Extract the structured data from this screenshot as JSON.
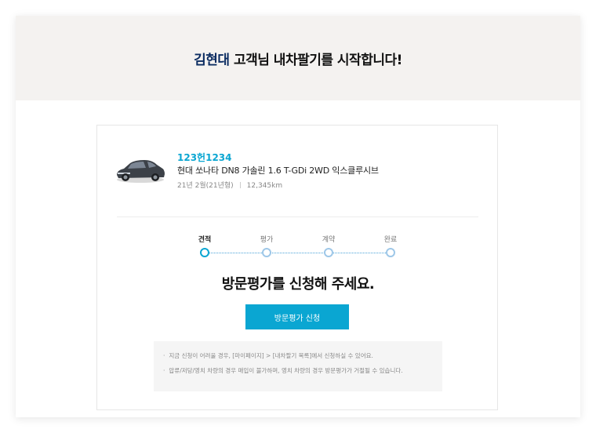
{
  "header": {
    "name": "김현대",
    "title_rest": " 고객님 내차팔기를 시작합니다!"
  },
  "car": {
    "plate": "123헌1234",
    "model": "현대 쏘나타 DN8 가솔린 1.6 T-GDi 2WD 익스클루시브",
    "year": "21년 2월(21년형)",
    "mileage": "12,345km"
  },
  "steps": [
    {
      "label": "견적",
      "active": true
    },
    {
      "label": "평가",
      "active": false
    },
    {
      "label": "계약",
      "active": false
    },
    {
      "label": "완료",
      "active": false
    }
  ],
  "message": "방문평가를 신청해 주세요.",
  "button": {
    "label": "방문평가 신청"
  },
  "notes": [
    "지금 신청이 어려울 경우, [마이페이지] > [내차팔기 목록]에서 신청하실 수 있어요.",
    "압류/저당/영치 차량의 경우 매입이 불가하며, 영치 차량의 경우 방문평가가 거절될 수 있습니다."
  ],
  "colors": {
    "accent": "#0aa6d2",
    "name": "#0c2d62",
    "header_bg": "#f4f2f0"
  }
}
